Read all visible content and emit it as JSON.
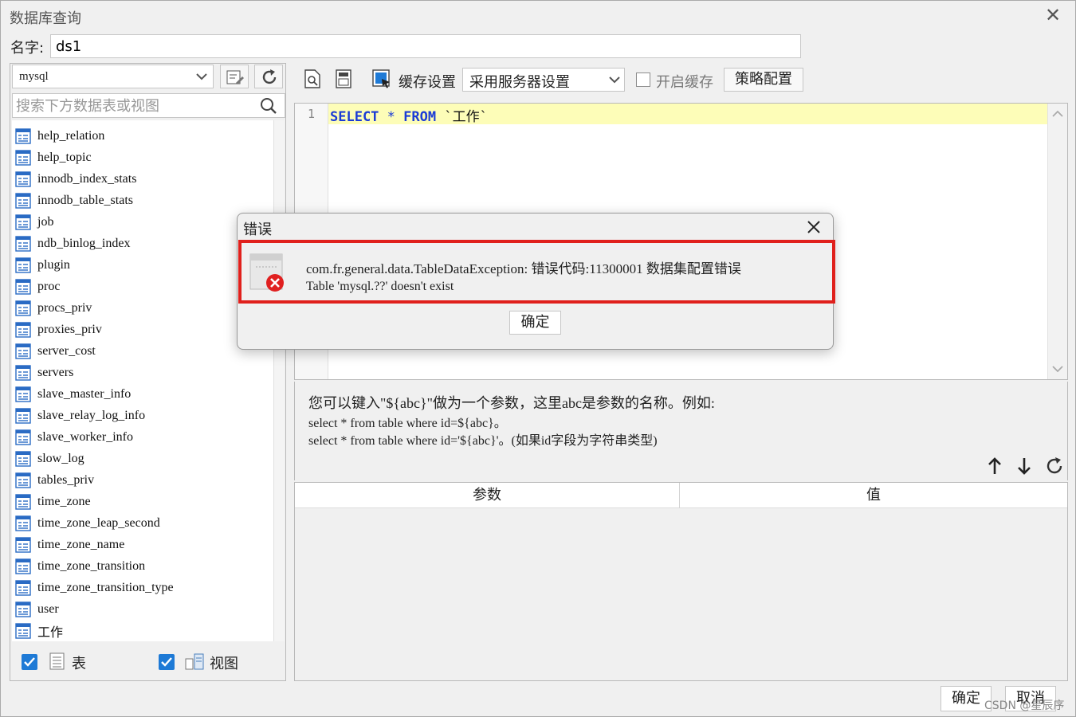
{
  "window": {
    "title": "数据库查询",
    "close": "✕"
  },
  "name_field": {
    "label": "名字:",
    "value": "ds1"
  },
  "left_panel": {
    "db_select_value": "mysql",
    "search_placeholder": "搜索下方数据表或视图",
    "tables": [
      "help_relation",
      "help_topic",
      "innodb_index_stats",
      "innodb_table_stats",
      "job",
      "ndb_binlog_index",
      "plugin",
      "proc",
      "procs_priv",
      "proxies_priv",
      "server_cost",
      "servers",
      "slave_master_info",
      "slave_relay_log_info",
      "slave_worker_info",
      "slow_log",
      "tables_priv",
      "time_zone",
      "time_zone_leap_second",
      "time_zone_name",
      "time_zone_transition",
      "time_zone_transition_type",
      "user",
      "工作"
    ],
    "filter_table_label": "表",
    "filter_view_label": "视图",
    "filter_table_checked": true,
    "filter_view_checked": true
  },
  "toolbar": {
    "cache_settings_label": "缓存设置",
    "server_select_value": "采用服务器设置",
    "enable_cache_label": "开启缓存",
    "strategy_button": "策略配置"
  },
  "editor": {
    "line_number": "1",
    "code": {
      "kw1": "SELECT",
      "star": "*",
      "kw2": "FROM",
      "table": "`工作`"
    }
  },
  "hint": {
    "line1": "您可以键入\"${abc}\"做为一个参数，这里abc是参数的名称。例如:",
    "line2": "select * from table where id=${abc}。",
    "line3": "select * from table where id='${abc}'。(如果id字段为字符串类型)"
  },
  "params_table": {
    "col_param": "参数",
    "col_value": "值"
  },
  "footer": {
    "ok": "确定",
    "cancel": "取消",
    "watermark": "CSDN @星辰序"
  },
  "error_dialog": {
    "title": "错误",
    "message_line1": "com.fr.general.data.TableDataException: 错误代码:11300001 数据集配置错误",
    "message_line2": "Table 'mysql.??' doesn't exist",
    "ok": "确定"
  },
  "colors": {
    "accent": "#1e7ad6",
    "error_highlight": "#e0201c",
    "current_line": "#fdfdb8",
    "keyword": "#1a3bd6"
  }
}
